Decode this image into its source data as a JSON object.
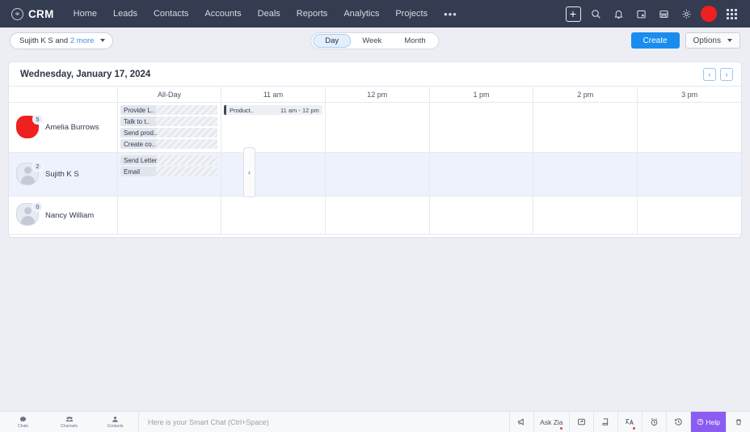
{
  "topnav": {
    "brand": "CRM",
    "items": [
      {
        "label": "Home"
      },
      {
        "label": "Leads"
      },
      {
        "label": "Contacts"
      },
      {
        "label": "Accounts"
      },
      {
        "label": "Deals"
      },
      {
        "label": "Reports"
      },
      {
        "label": "Analytics"
      },
      {
        "label": "Projects"
      }
    ],
    "overflow": "•••",
    "icons": [
      {
        "name": "add-icon",
        "glyph": "+"
      },
      {
        "name": "search-icon"
      },
      {
        "name": "notification-bell-icon"
      },
      {
        "name": "calendar-icon"
      },
      {
        "name": "save-icon"
      },
      {
        "name": "settings-gear-icon"
      },
      {
        "name": "user-avatar"
      },
      {
        "name": "apps-grid-icon"
      }
    ]
  },
  "toolbar": {
    "user_filter_prefix": "Sujith K S and ",
    "user_filter_more": "2 more",
    "views": [
      {
        "label": "Day",
        "active": true
      },
      {
        "label": "Week",
        "active": false
      },
      {
        "label": "Month",
        "active": false
      }
    ],
    "create_label": "Create",
    "options_label": "Options"
  },
  "calendar": {
    "date_title": "Wednesday, January 17, 2024",
    "prev_label": "‹",
    "next_label": "›",
    "columns": [
      "All-Day",
      "11 am",
      "12 pm",
      "1 pm",
      "2 pm",
      "3 pm"
    ],
    "collapse_label": "‹",
    "rows": [
      {
        "user": "Amelia Burrows",
        "badge": "5",
        "avatar_type": "red",
        "highlight": false,
        "all_day_events": [
          {
            "title": "Provide L.."
          },
          {
            "title": "Talk to t.."
          },
          {
            "title": "Send prod.."
          },
          {
            "title": "Create co.."
          }
        ],
        "timed_events": [
          {
            "title": "Product..",
            "time": "11 am - 12 pm",
            "column": "11 am"
          }
        ]
      },
      {
        "user": "Sujith K S",
        "badge": "2",
        "avatar_type": "person",
        "highlight": true,
        "all_day_events": [
          {
            "title": "Send Letter"
          },
          {
            "title": "Email"
          }
        ],
        "timed_events": []
      },
      {
        "user": "Nancy William",
        "badge": "0",
        "avatar_type": "person",
        "highlight": false,
        "all_day_events": [],
        "timed_events": []
      }
    ]
  },
  "bottombar": {
    "tools": [
      {
        "label": "Chats",
        "icon": "chat-icon"
      },
      {
        "label": "Channels",
        "icon": "channels-icon"
      },
      {
        "label": "Contacts",
        "icon": "contacts-icon"
      }
    ],
    "chat_placeholder": "Here is your Smart Chat (Ctrl+Space)",
    "right_items": [
      {
        "name": "announcement-icon",
        "label": ""
      },
      {
        "name": "ask-zia-button",
        "label": "Ask Zia"
      },
      {
        "name": "share-icon",
        "label": ""
      },
      {
        "name": "notes-icon",
        "label": ""
      },
      {
        "name": "zia-translate-icon",
        "label": ""
      },
      {
        "name": "alarm-clock-icon",
        "label": ""
      },
      {
        "name": "history-icon",
        "label": ""
      },
      {
        "name": "help-button",
        "label": "Help"
      },
      {
        "name": "trash-icon",
        "label": ""
      }
    ]
  },
  "colors": {
    "nav_bg": "#333c51",
    "accent_blue": "#1a8cf0",
    "link_blue": "#4a90e2",
    "help_purple": "#8a5cf0",
    "avatar_red": "#ee2020",
    "row_highlight": "#edf2fc"
  }
}
